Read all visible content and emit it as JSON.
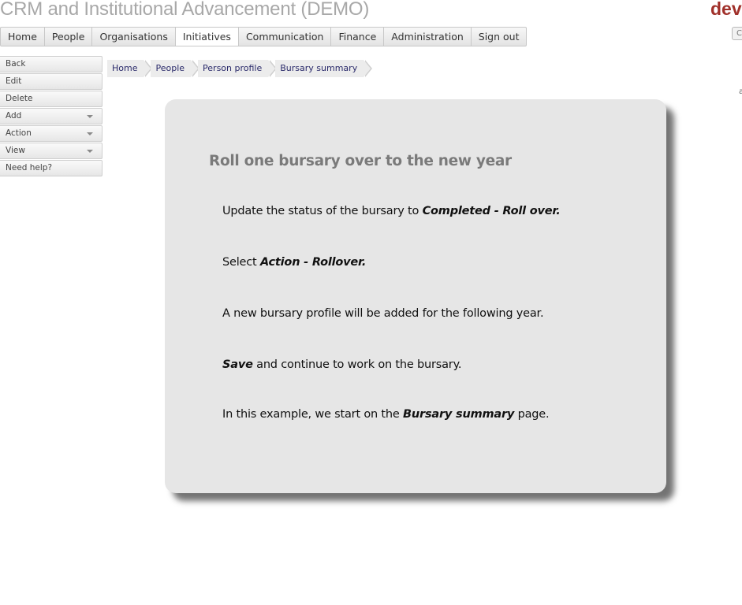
{
  "app": {
    "title": "CRM and Institutional Advancement (DEMO)",
    "brand": "dev",
    "top_right_button": "C",
    "top_right_text": "a"
  },
  "main_nav": {
    "tabs": [
      {
        "label": "Home"
      },
      {
        "label": "People"
      },
      {
        "label": "Organisations"
      },
      {
        "label": "Initiatives",
        "active": true
      },
      {
        "label": "Communication"
      },
      {
        "label": "Finance"
      },
      {
        "label": "Administration"
      },
      {
        "label": "Sign out"
      }
    ]
  },
  "side_menu": {
    "items": [
      {
        "label": "Back"
      },
      {
        "label": "Edit"
      },
      {
        "label": "Delete"
      },
      {
        "label": "Add",
        "dropdown": true
      },
      {
        "label": "Action",
        "dropdown": true
      },
      {
        "label": "View",
        "dropdown": true
      },
      {
        "label": "Need help?"
      }
    ]
  },
  "breadcrumb": [
    "Home",
    "People",
    "Person profile",
    "Bursary summary"
  ],
  "help_card": {
    "title": "Roll one bursary over to the new year",
    "step1": {
      "pre": "Update the status of the bursary to ",
      "em": "Completed - Roll over."
    },
    "step2": {
      "pre": "Select ",
      "em": "Action - Rollover."
    },
    "step3": {
      "text": "A new bursary profile will be added for the following year."
    },
    "step4": {
      "em": "Save",
      "post": " and continue to work on the bursary."
    },
    "step5": {
      "pre": "In this example, we start on the ",
      "em": "Bursary summary",
      "post": " page."
    }
  },
  "colors": {
    "title_gray": "#a8a8a8",
    "brand_red": "#a0302a",
    "card_bg": "#e6e6e6",
    "crumb_text": "#2a2a6a"
  }
}
